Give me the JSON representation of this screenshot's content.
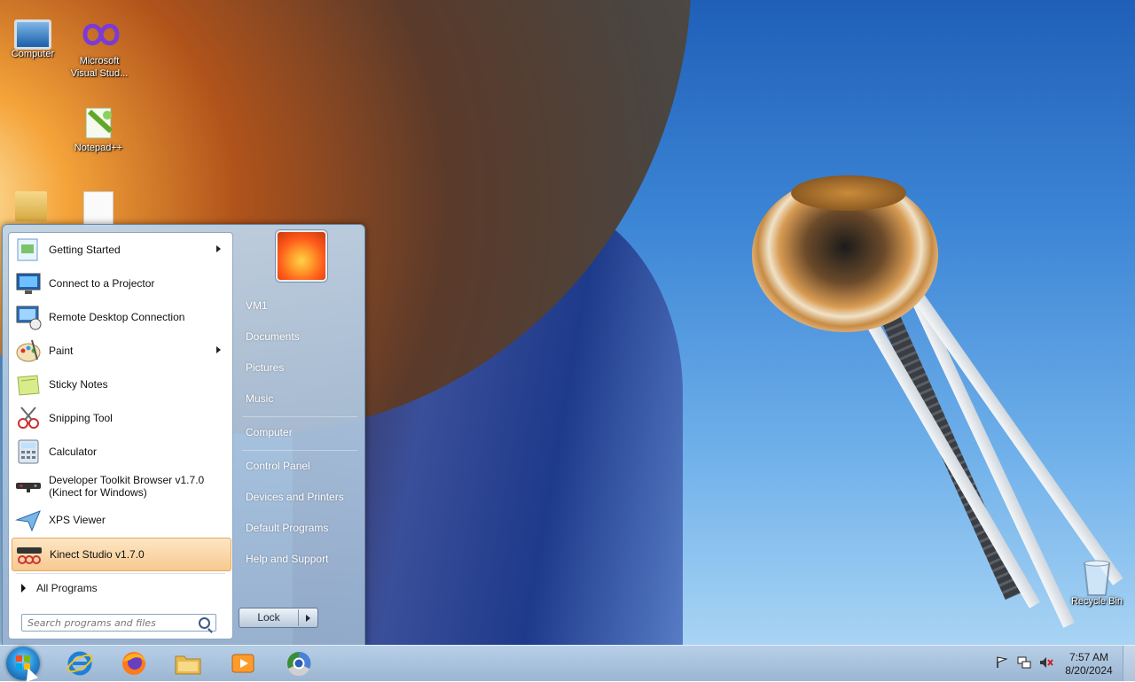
{
  "desktop": {
    "icons": [
      {
        "name": "computer",
        "label": "Computer"
      },
      {
        "name": "visual-studio",
        "label": "Microsoft Visual Stud..."
      },
      {
        "name": "notepadpp",
        "label": "Notepad++"
      },
      {
        "name": "folder",
        "label": ""
      },
      {
        "name": "file",
        "label": ""
      },
      {
        "name": "recycle-bin",
        "label": "Recycle Bin"
      }
    ]
  },
  "start_menu": {
    "programs": [
      {
        "label": "Getting Started",
        "icon": "getting-started-icon",
        "submenu": true
      },
      {
        "label": "Connect to a Projector",
        "icon": "projector-icon",
        "submenu": false
      },
      {
        "label": "Remote Desktop Connection",
        "icon": "remote-desktop-icon",
        "submenu": false
      },
      {
        "label": "Paint",
        "icon": "paint-icon",
        "submenu": true
      },
      {
        "label": "Sticky Notes",
        "icon": "sticky-notes-icon",
        "submenu": false
      },
      {
        "label": "Snipping Tool",
        "icon": "snipping-tool-icon",
        "submenu": false
      },
      {
        "label": "Calculator",
        "icon": "calculator-icon",
        "submenu": false
      },
      {
        "label": "Developer Toolkit Browser v1.7.0",
        "label2": "(Kinect for Windows)",
        "icon": "kinect-icon",
        "submenu": false
      },
      {
        "label": "XPS Viewer",
        "icon": "xps-viewer-icon",
        "submenu": false
      },
      {
        "label": "Kinect Studio v1.7.0",
        "icon": "kinect-studio-icon",
        "submenu": false,
        "highlighted": true
      }
    ],
    "all_programs": "All Programs",
    "search_placeholder": "Search programs and files",
    "right": {
      "user": "VM1",
      "documents": "Documents",
      "pictures": "Pictures",
      "music": "Music",
      "computer": "Computer",
      "control_panel": "Control Panel",
      "devices": "Devices and Printers",
      "default_programs": "Default Programs",
      "help": "Help and Support"
    },
    "lock_label": "Lock"
  },
  "taskbar": {
    "pinned": [
      "internet-explorer-icon",
      "firefox-icon",
      "file-explorer-icon",
      "media-player-icon",
      "chrome-icon"
    ],
    "time": "7:57 AM",
    "date": "8/20/2024"
  }
}
